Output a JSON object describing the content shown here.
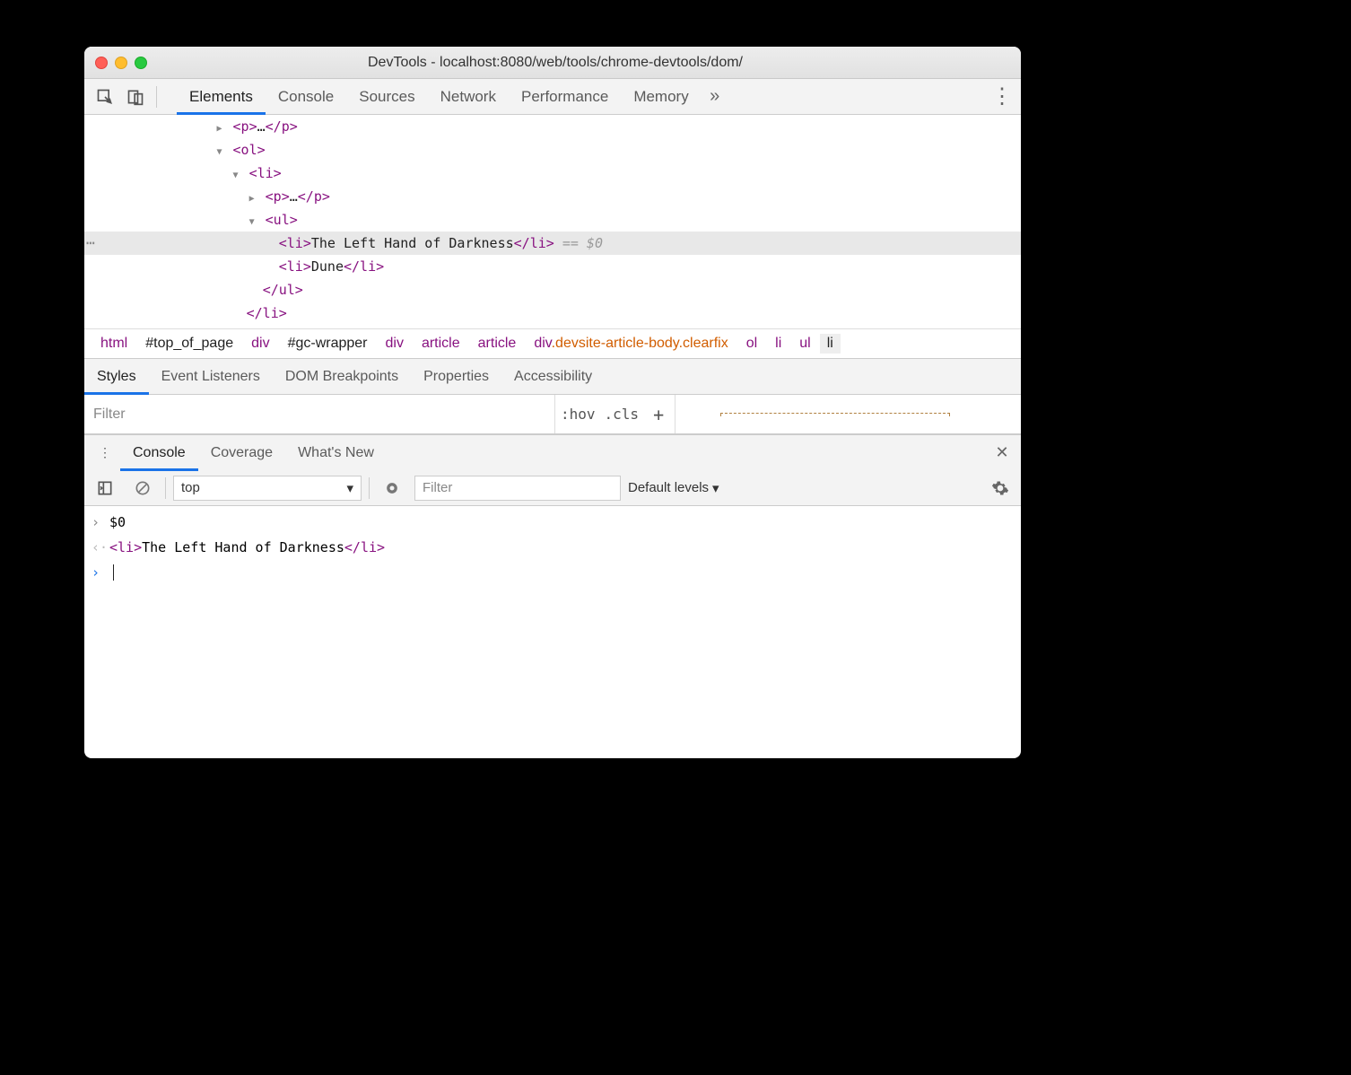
{
  "window": {
    "title": "DevTools - localhost:8080/web/tools/chrome-devtools/dom/"
  },
  "tabs": {
    "elements": "Elements",
    "console": "Console",
    "sources": "Sources",
    "network": "Network",
    "performance": "Performance",
    "memory": "Memory",
    "more": "»"
  },
  "dom": {
    "l1": {
      "arrow": "▶",
      "open": "<p>",
      "ellipsis": "…",
      "close": "</p>"
    },
    "l2": {
      "arrow": "▼",
      "tag": "<ol>"
    },
    "l3": {
      "arrow": "▼",
      "tag": "<li>"
    },
    "l4": {
      "arrow": "▶",
      "open": "<p>",
      "ellipsis": "…",
      "close": "</p>"
    },
    "l5": {
      "arrow": "▼",
      "tag": "<ul>"
    },
    "l6": {
      "open": "<li>",
      "text": "The Left Hand of Darkness",
      "close": "</li>",
      "suffix": " == $0"
    },
    "l7": {
      "open": "<li>",
      "text": "Dune",
      "close": "</li>"
    },
    "l8": {
      "tag": "</ul>"
    },
    "l9": {
      "tag": "</li>"
    }
  },
  "breadcrumb": {
    "b1": "html",
    "b2": "#top_of_page",
    "b3": "div",
    "b4": "#gc-wrapper",
    "b5": "div",
    "b6": "article",
    "b7": "article",
    "b8": "div.devsite-article-body.clearfix",
    "b9": "ol",
    "b10": "li",
    "b11": "ul",
    "b12": "li"
  },
  "stabs": {
    "styles": "Styles",
    "events": "Event Listeners",
    "dom": "DOM Breakpoints",
    "props": "Properties",
    "a11y": "Accessibility"
  },
  "filter": {
    "placeholder": "Filter",
    "hov": ":hov",
    "cls": ".cls",
    "plus": "+"
  },
  "drawer": {
    "console": "Console",
    "coverage": "Coverage",
    "whatsnew": "What's New"
  },
  "ctool": {
    "context": "top",
    "filter": "Filter",
    "levels": "Default levels",
    "chevron": "▾"
  },
  "console": {
    "r1": "$0",
    "r2": {
      "open": "<li>",
      "text": "The Left Hand of Darkness",
      "close": "</li>"
    }
  }
}
